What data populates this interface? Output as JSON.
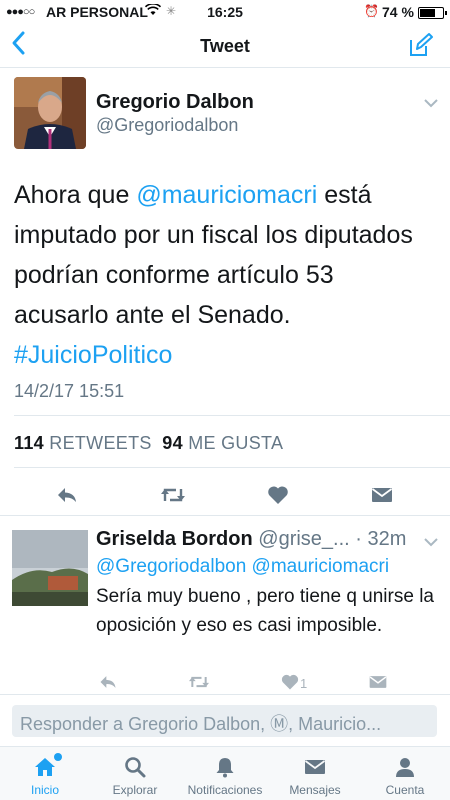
{
  "status_bar": {
    "signal": "●●●○○",
    "carrier": "AR PERSONAL",
    "time": "16:25",
    "battery_text": "74 %",
    "battery_level": 0.74
  },
  "nav": {
    "back_label": "‹",
    "title": "Tweet"
  },
  "tweet": {
    "author_name": "Gregorio Dalbon",
    "author_handle": "@Gregoriodalbon",
    "text_part1": "Ahora que ",
    "mention": "@mauriciomacri",
    "text_part2": " está imputado por un fiscal los diputados podrían conforme artículo 53 acusarlo ante el Senado. ",
    "hashtag": "#JuicioPolitico",
    "date": "14/2/17 15:51",
    "retweets_count": "114",
    "retweets_label": "RETWEETS",
    "likes_count": "94",
    "likes_label": "ME GUSTA"
  },
  "reply": {
    "name": "Griselda Bordon",
    "handle": "@grise_...",
    "time": "· 32m",
    "mentions": "@Gregoriodalbon @mauriciomacri",
    "text": "Sería muy bueno , pero tiene q unirse la oposición y eso es casi imposible.",
    "like_count": "1"
  },
  "composer": {
    "placeholder": "Responder a Gregorio Dalbon, Ⓜ, Mauricio..."
  },
  "tabs": [
    {
      "label": "Inicio",
      "icon": "home-icon",
      "active": true
    },
    {
      "label": "Explorar",
      "icon": "search-icon"
    },
    {
      "label": "Notificaciones",
      "icon": "bell-icon"
    },
    {
      "label": "Mensajes",
      "icon": "envelope-icon"
    },
    {
      "label": "Cuenta",
      "icon": "person-icon"
    }
  ],
  "colors": {
    "accent": "#1da1f2",
    "secondary_text": "#657786",
    "divider": "#e1e8ed"
  }
}
